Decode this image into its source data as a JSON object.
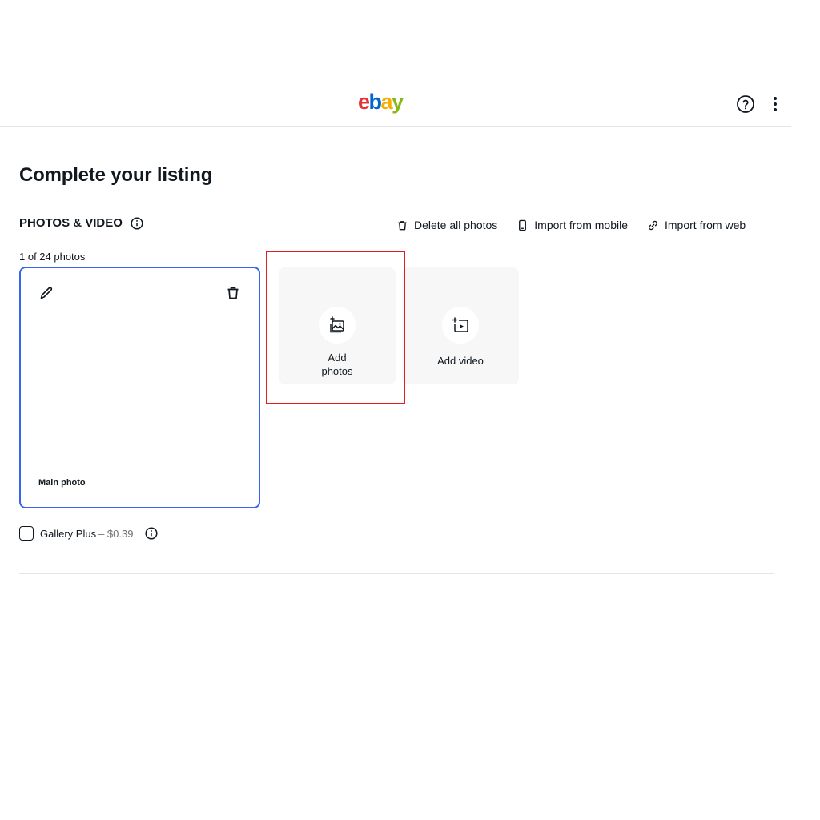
{
  "header": {
    "logo_letters": [
      "e",
      "b",
      "a",
      "y"
    ],
    "logo_colors": [
      "#e53238",
      "#0064d2",
      "#f5af02",
      "#86b817"
    ],
    "help_icon": "help-circle-icon",
    "more_icon": "more-vertical-icon"
  },
  "page": {
    "title": "Complete your listing"
  },
  "photos_section": {
    "title": "PHOTOS & VIDEO",
    "info_icon": "info-icon",
    "actions": {
      "delete_all": "Delete all photos",
      "import_mobile": "Import from mobile",
      "import_web": "Import from web"
    },
    "count_text": "1 of 24 photos",
    "main_photo_label": "Main photo",
    "add_photos_label": "Add photos",
    "add_video_label": "Add video"
  },
  "gallery_plus": {
    "label": "Gallery Plus",
    "price": "– $0.39",
    "checked": false
  },
  "colors": {
    "accent_blue": "#3665f3",
    "highlight_red": "#e0201e",
    "tile_bg": "#f7f7f7",
    "text": "#111820",
    "muted": "#707070"
  }
}
